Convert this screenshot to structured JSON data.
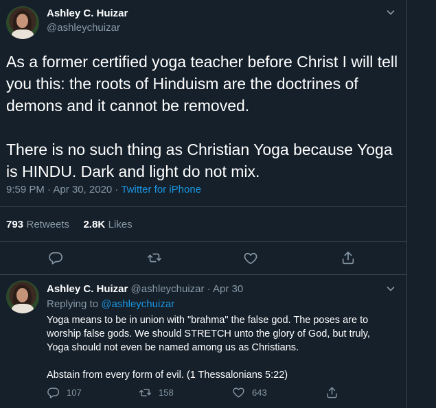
{
  "tweet": {
    "author_name": "Ashley C. Huizar",
    "author_handle": "@ashleychuizar",
    "paragraphs": [
      "As a former certified yoga teacher before Christ I will tell you this: the roots of Hinduism are the doctrines of demons and it cannot be removed.",
      "There is no such thing as Christian Yoga because Yoga is HINDU. Dark and light do not mix."
    ],
    "timestamp": "9:59 PM · Apr 30, 2020",
    "separator": " · ",
    "source": "Twitter for iPhone",
    "retweets_count": "793",
    "retweets_label": "Retweets",
    "likes_count": "2.8K",
    "likes_label": "Likes"
  },
  "reply": {
    "author_name": "Ashley C. Huizar",
    "author_handle": "@ashleychuizar",
    "date": "· Apr 30",
    "replying_to_label": "Replying to",
    "replying_to_handle": "@ashleychuizar",
    "paragraphs": [
      "Yoga means to be in union with \"brahma\" the false god. The poses are to worship false gods. We should STRETCH unto the glory of God, but truly, Yoga should not even be named among us as Christians.",
      "Abstain from every form of evil. (1 Thessalonians 5:22)"
    ],
    "reply_count": "107",
    "retweet_count": "158",
    "like_count": "643"
  },
  "colors": {
    "background": "#15202b",
    "border": "#38444d",
    "muted": "#8899a6",
    "link": "#1b95e0",
    "text": "#ffffff"
  },
  "icons": [
    "chevron-down-icon",
    "reply-icon",
    "retweet-icon",
    "like-icon",
    "share-icon"
  ]
}
